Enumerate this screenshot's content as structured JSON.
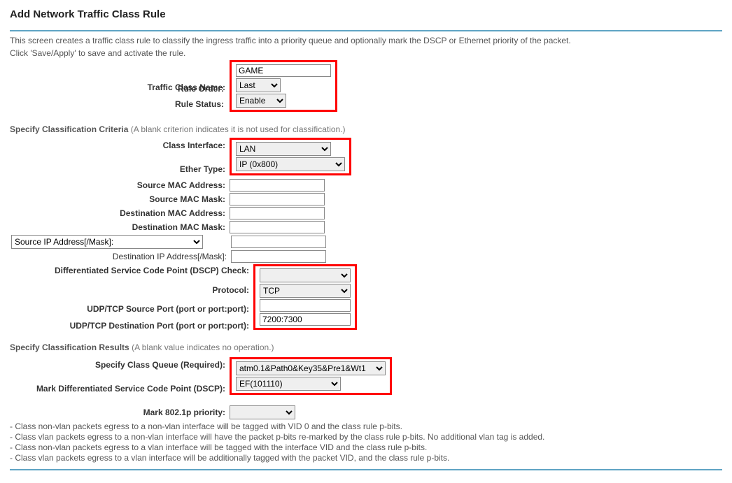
{
  "title": "Add Network Traffic Class Rule",
  "intro_line1": "This screen creates a traffic class rule to classify the ingress traffic into a priority queue and optionally mark the DSCP or Ethernet priority of the packet.",
  "intro_line2": "Click 'Save/Apply' to save and activate the rule.",
  "labels": {
    "traffic_class_name": "Traffic Class Name:",
    "rule_order": "Rule Order:",
    "rule_status": "Rule Status:",
    "class_interface": "Class Interface:",
    "ether_type": "Ether Type:",
    "src_mac": "Source MAC Address:",
    "src_mac_mask": "Source MAC Mask:",
    "dst_mac": "Destination MAC Address:",
    "dst_mac_mask": "Destination MAC Mask:",
    "src_ip_dropdown": "Source IP Address[/Mask]:",
    "dst_ip": "Destination IP Address[/Mask]:",
    "dscp_check": "Differentiated Service Code Point (DSCP) Check:",
    "protocol": "Protocol:",
    "src_port": "UDP/TCP Source Port (port or port:port):",
    "dst_port": "UDP/TCP Destination Port (port or port:port):",
    "class_queue": "Specify Class Queue (Required):",
    "mark_dscp": "Mark Differentiated Service Code Point (DSCP):",
    "mark_8021p": "Mark 802.1p priority:"
  },
  "sections": {
    "criteria_title": "Specify Classification Criteria",
    "criteria_hint": " (A blank criterion indicates it is not used for classification.)",
    "results_title": "Specify Classification Results",
    "results_hint": " (A blank value indicates no operation.)"
  },
  "values": {
    "traffic_class_name": "GAME",
    "rule_order": "Last",
    "rule_status": "Enable",
    "class_interface": "LAN",
    "ether_type": "IP (0x800)",
    "src_mac": "",
    "src_mac_mask": "",
    "dst_mac": "",
    "dst_mac_mask": "",
    "src_ip": "",
    "dst_ip": "",
    "dscp_check": "",
    "protocol": "TCP",
    "src_port": "",
    "dst_port": "7200:7300",
    "class_queue": "atm0.1&Path0&Key35&Pre1&Wt1",
    "mark_dscp": "EF(101110)",
    "mark_8021p": ""
  },
  "notes": {
    "n1": "- Class non-vlan packets egress to a non-vlan interface will be tagged with VID 0 and the class rule p-bits.",
    "n2": "- Class vlan packets egress to a non-vlan interface will have the packet p-bits re-marked by the class rule p-bits. No additional vlan tag is added.",
    "n3": "- Class non-vlan packets egress to a vlan interface will be tagged with the interface VID and the class rule p-bits.",
    "n4": "- Class vlan packets egress to a vlan interface will be additionally tagged with the packet VID, and the class rule p-bits."
  }
}
